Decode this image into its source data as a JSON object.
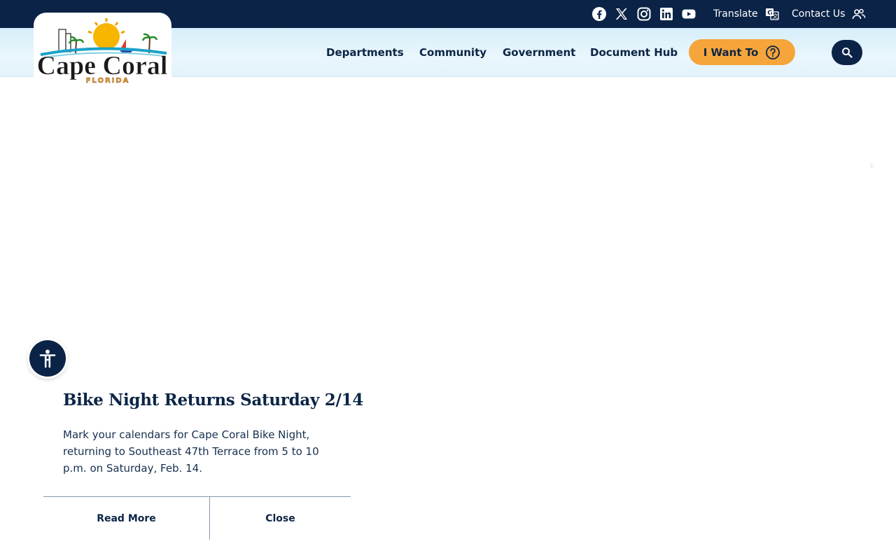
{
  "utility": {
    "social": [
      {
        "name": "facebook-icon",
        "label": "Facebook"
      },
      {
        "name": "x-twitter-icon",
        "label": "X"
      },
      {
        "name": "instagram-icon",
        "label": "Instagram"
      },
      {
        "name": "linkedin-icon",
        "label": "LinkedIn"
      },
      {
        "name": "youtube-icon",
        "label": "YouTube"
      }
    ],
    "translate_label": "Translate",
    "contact_label": "Contact Us"
  },
  "brand": {
    "name": "Cape Coral",
    "sub": "FLORIDA"
  },
  "nav": {
    "items": [
      "Departments",
      "Community",
      "Government",
      "Document Hub"
    ],
    "cta_label": "I Want To"
  },
  "news": {
    "title": "Bike Night Returns Saturday 2/14",
    "body": "Mark your calendars for Cape Coral Bike Night, returning to Southeast 47th Terrace from 5 to 10 p.m. on Saturday, Feb. 14.",
    "read_more_label": "Read More",
    "close_label": "Close"
  },
  "colors": {
    "navy": "#0b2347",
    "accent_orange": "#f5a53a",
    "header_light_blue": "#d6eefa"
  }
}
